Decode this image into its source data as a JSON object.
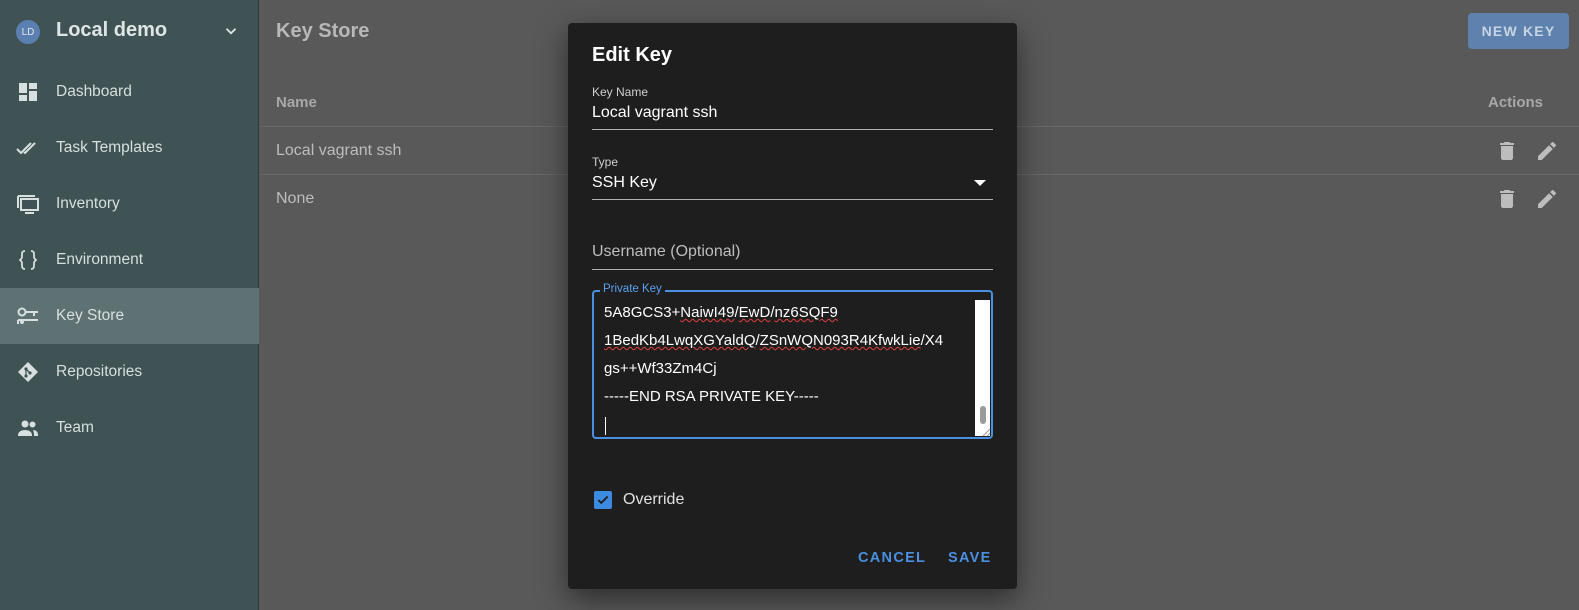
{
  "sidebar": {
    "avatar": "LD",
    "project_name": "Local demo",
    "items": [
      {
        "label": "Dashboard",
        "icon": "dashboard-icon"
      },
      {
        "label": "Task Templates",
        "icon": "double-check-icon"
      },
      {
        "label": "Inventory",
        "icon": "monitor-icon"
      },
      {
        "label": "Environment",
        "icon": "braces-icon"
      },
      {
        "label": "Key Store",
        "icon": "key-icon",
        "active": true
      },
      {
        "label": "Repositories",
        "icon": "git-icon"
      },
      {
        "label": "Team",
        "icon": "team-icon"
      }
    ]
  },
  "main": {
    "title": "Key Store",
    "new_key_label": "NEW KEY",
    "columns": {
      "name": "Name",
      "actions": "Actions"
    },
    "rows": [
      {
        "name": "Local vagrant ssh"
      },
      {
        "name": "None"
      }
    ]
  },
  "dialog": {
    "title": "Edit Key",
    "key_name_label": "Key Name",
    "key_name_value": "Local vagrant ssh",
    "type_label": "Type",
    "type_value": "SSH Key",
    "username_placeholder": "Username (Optional)",
    "private_key_label": "Private Key",
    "private_key_lines": [
      "5A8GCS3+NaiwI49/EwD/nz6SQF9",
      "1BedKb4LwqXGYaldQ/ZSnWQN093R4KfwkLie/X4",
      "gs++Wf33Zm4Cj",
      "-----END RSA PRIVATE KEY-----"
    ],
    "override_label": "Override",
    "override_checked": true,
    "cancel_label": "CANCEL",
    "save_label": "SAVE"
  },
  "colors": {
    "sidebar_bg": "#3f5254",
    "sidebar_active": "#5f7273",
    "overlay_bg": "#595959",
    "dialog_bg": "#1e1e1e",
    "accent": "#4a90e0",
    "new_key_btn": "#5e82ad"
  }
}
